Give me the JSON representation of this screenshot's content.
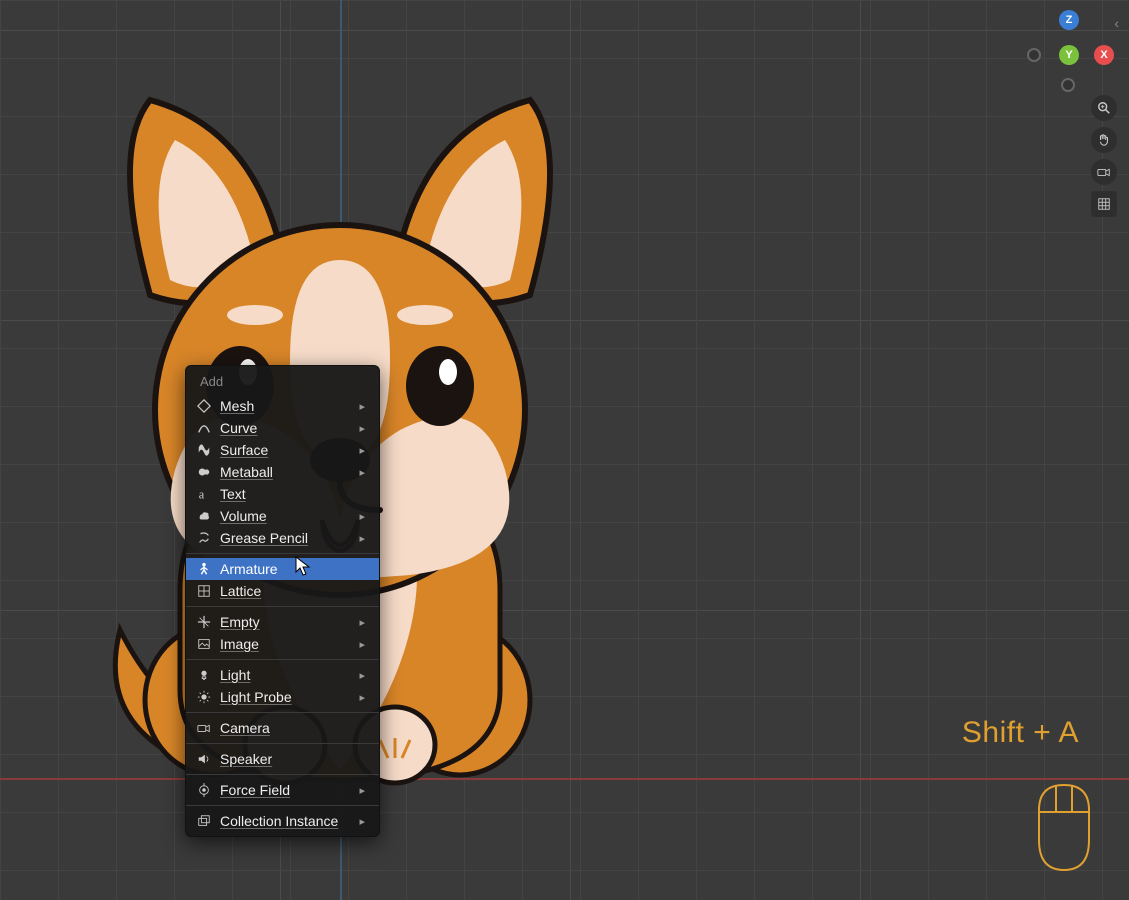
{
  "menu": {
    "title": "Add",
    "items": [
      {
        "label": "Mesh",
        "icon": "mesh-icon",
        "submenu": true
      },
      {
        "label": "Curve",
        "icon": "curve-icon",
        "submenu": true
      },
      {
        "label": "Surface",
        "icon": "surface-icon",
        "submenu": true
      },
      {
        "label": "Metaball",
        "icon": "metaball-icon",
        "submenu": true
      },
      {
        "label": "Text",
        "icon": "text-icon",
        "submenu": false
      },
      {
        "label": "Volume",
        "icon": "volume-icon",
        "submenu": true
      },
      {
        "label": "Grease Pencil",
        "icon": "greasepencil-icon",
        "submenu": true
      },
      {
        "sep": true
      },
      {
        "label": "Armature",
        "icon": "armature-icon",
        "submenu": false,
        "highlighted": true
      },
      {
        "label": "Lattice",
        "icon": "lattice-icon",
        "submenu": false
      },
      {
        "sep": true
      },
      {
        "label": "Empty",
        "icon": "empty-icon",
        "submenu": true
      },
      {
        "label": "Image",
        "icon": "image-icon",
        "submenu": true
      },
      {
        "sep": true
      },
      {
        "label": "Light",
        "icon": "light-icon",
        "submenu": true
      },
      {
        "label": "Light Probe",
        "icon": "lightprobe-icon",
        "submenu": true
      },
      {
        "sep": true
      },
      {
        "label": "Camera",
        "icon": "camera-icon",
        "submenu": false
      },
      {
        "sep": true
      },
      {
        "label": "Speaker",
        "icon": "speaker-icon",
        "submenu": false
      },
      {
        "sep": true
      },
      {
        "label": "Force Field",
        "icon": "forcefield-icon",
        "submenu": true
      },
      {
        "sep": true
      },
      {
        "label": "Collection Instance",
        "icon": "collection-icon",
        "submenu": true
      }
    ]
  },
  "gizmo": {
    "x": "X",
    "y": "Y",
    "z": "Z"
  },
  "hint": "Shift + A",
  "colors": {
    "corgi_orange": "#d88528",
    "corgi_cream": "#f6dbc8",
    "corgi_dark": "#1b1310",
    "menu_highlight": "#3d72c5",
    "hint": "#e0a030"
  }
}
